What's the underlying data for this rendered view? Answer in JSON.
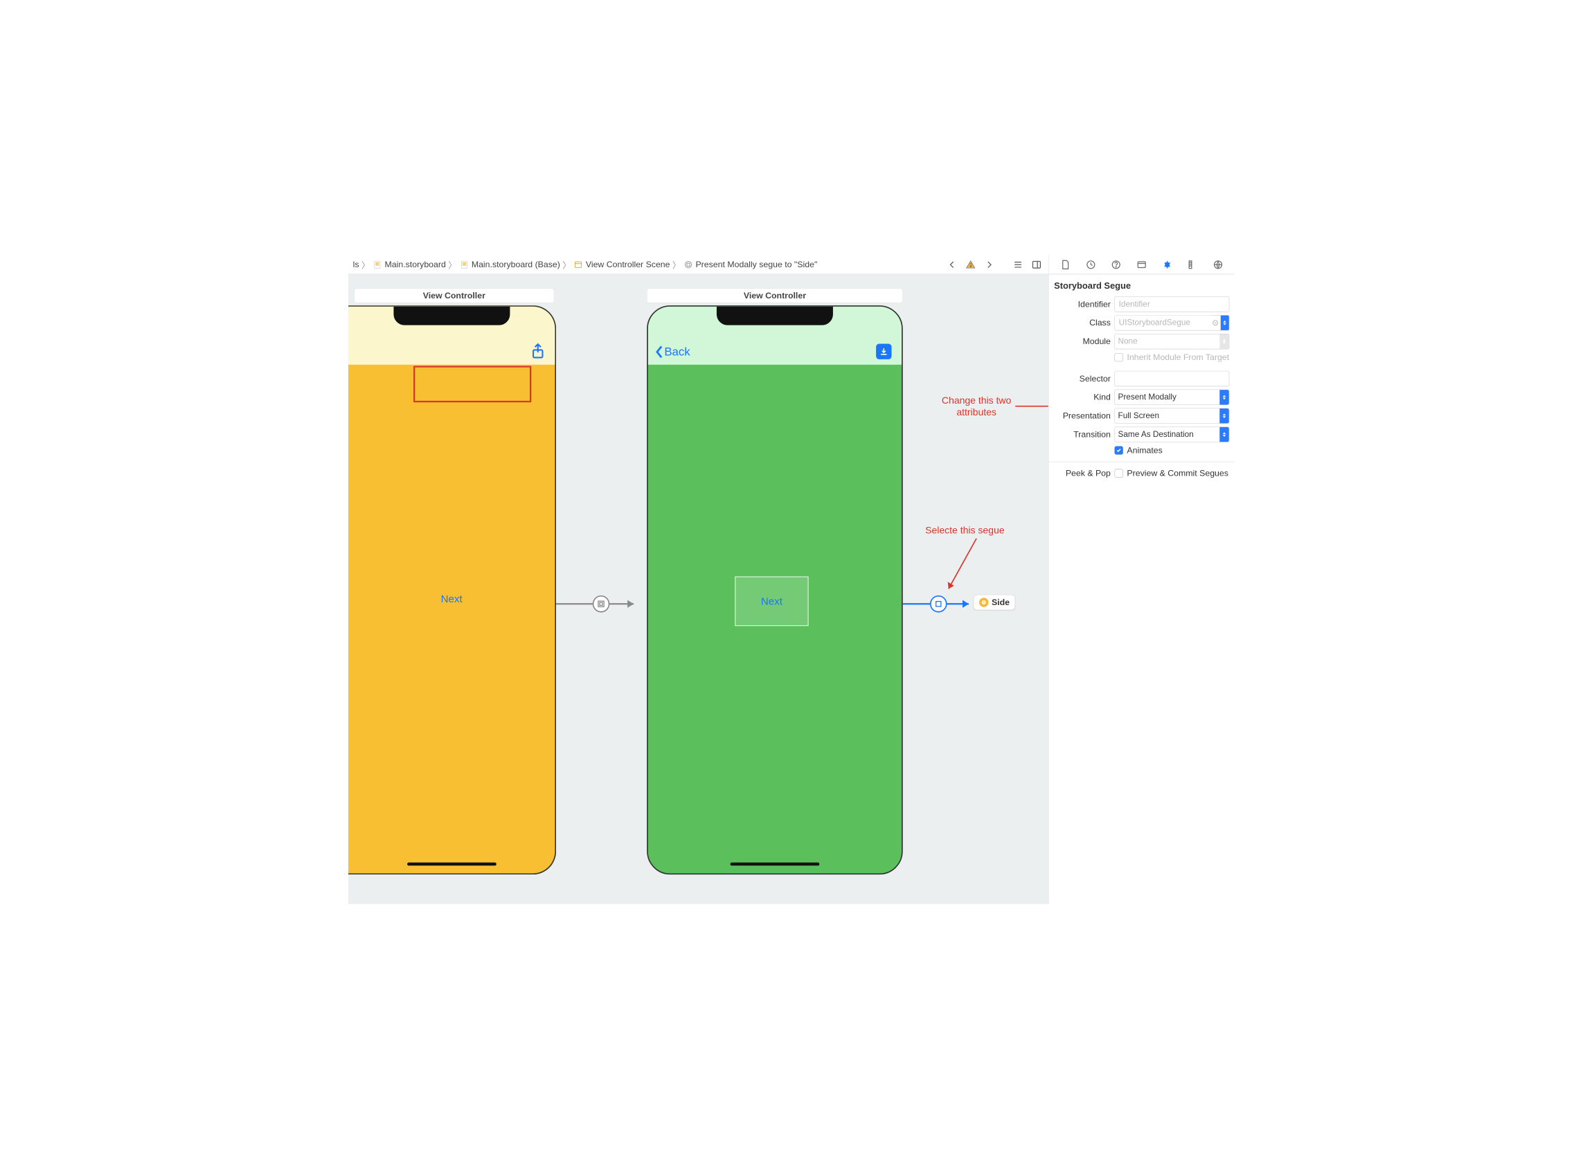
{
  "breadcrumb": {
    "items": [
      "ls",
      "Main.storyboard",
      "Main.storyboard (Base)",
      "View Controller Scene",
      "Present Modally segue to \"Side\""
    ]
  },
  "canvas": {
    "left_title": "View Controller",
    "right_title": "View Controller",
    "left_button": "Next",
    "right_button": "Next",
    "back_label": "Back",
    "side_chip": "Side"
  },
  "annotations": {
    "top_line1": "Change this two",
    "top_line2": "attributes",
    "bottom": "Selecte this segue"
  },
  "inspector": {
    "section_title": "Storyboard Segue",
    "identifier": {
      "label": "Identifier",
      "placeholder": "Identifier",
      "value": ""
    },
    "klass": {
      "label": "Class",
      "value": "UIStoryboardSegue"
    },
    "module": {
      "label": "Module",
      "value": "None"
    },
    "inherit": {
      "label": "Inherit Module From Target",
      "checked": false
    },
    "selector": {
      "label": "Selector",
      "value": ""
    },
    "kind": {
      "label": "Kind",
      "value": "Present Modally"
    },
    "presentation": {
      "label": "Presentation",
      "value": "Full Screen"
    },
    "transition": {
      "label": "Transition",
      "value": "Same As Destination"
    },
    "animates": {
      "label": "Animates",
      "checked": true
    },
    "peek": {
      "label": "Peek & Pop",
      "option": "Preview & Commit Segues",
      "checked": false
    }
  }
}
